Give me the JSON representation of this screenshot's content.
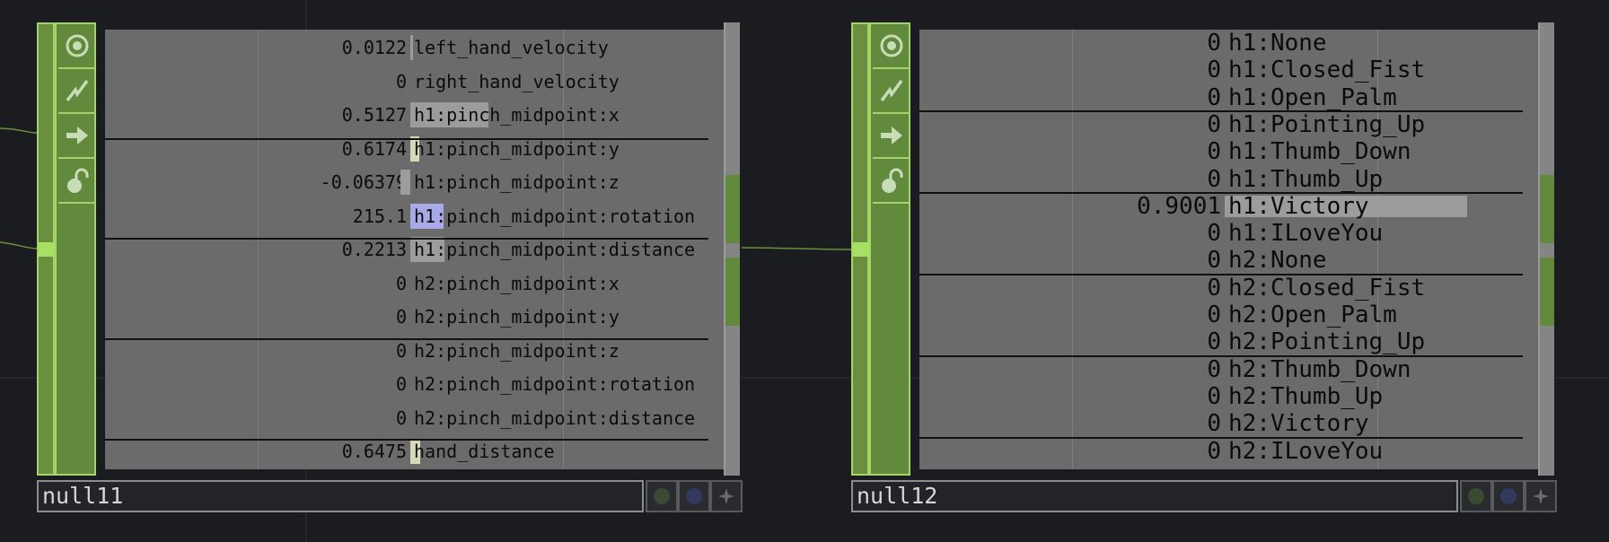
{
  "colors": {
    "background": "#1b1c20",
    "node_green": "#628a3d",
    "node_green_border": "#a3d46c",
    "viewer_gray": "#6b6b6b",
    "bar_gray": "#9c9c9c",
    "bar_cream": "#d8d8b8",
    "bar_blue": "#a9a9e8",
    "wire": "#6c8f3f"
  },
  "icons": [
    "viewer-toggle-icon",
    "bypass-icon",
    "export-icon",
    "lock-icon"
  ],
  "nodes": [
    {
      "name": "null11",
      "channels": [
        {
          "value": "0.0122",
          "label": "left_hand_velocity",
          "level": 0.012,
          "color": "#9c9c9c"
        },
        {
          "value": "0",
          "label": "right_hand_velocity",
          "level": 0,
          "color": "#9c9c9c"
        },
        {
          "value": "0.5127",
          "label": "h1:pinch_midpoint:x",
          "level": 0.5127,
          "color": "#9c9c9c"
        },
        {
          "value": "0.6174",
          "label": "h1:pinch_midpoint:y",
          "level": 0.0617,
          "color": "#d8d8b8"
        },
        {
          "value": "-0.06379",
          "label": "h1:pinch_midpoint:z",
          "level": -0.064,
          "color": "#9c9c9c"
        },
        {
          "value": "215.1",
          "label": "h1:pinch_midpoint:rotation",
          "level": 0.215,
          "color": "#a9a9e8"
        },
        {
          "value": "0.2213",
          "label": "h1:pinch_midpoint:distance",
          "level": 0.2213,
          "color": "#9c9c9c"
        },
        {
          "value": "0",
          "label": "h2:pinch_midpoint:x",
          "level": 0,
          "color": "#9c9c9c"
        },
        {
          "value": "0",
          "label": "h2:pinch_midpoint:y",
          "level": 0,
          "color": "#9c9c9c"
        },
        {
          "value": "0",
          "label": "h2:pinch_midpoint:z",
          "level": 0,
          "color": "#9c9c9c"
        },
        {
          "value": "0",
          "label": "h2:pinch_midpoint:rotation",
          "level": 0,
          "color": "#9c9c9c"
        },
        {
          "value": "0",
          "label": "h2:pinch_midpoint:distance",
          "level": 0,
          "color": "#9c9c9c"
        },
        {
          "value": "0.6475",
          "label": "hand_distance",
          "level": 0.0647,
          "color": "#d8d8b8"
        }
      ]
    },
    {
      "name": "null12",
      "channels": [
        {
          "value": "0",
          "label": "h1:None",
          "level": 0,
          "color": "#9c9c9c"
        },
        {
          "value": "0",
          "label": "h1:Closed_Fist",
          "level": 0,
          "color": "#9c9c9c"
        },
        {
          "value": "0",
          "label": "h1:Open_Palm",
          "level": 0,
          "color": "#9c9c9c"
        },
        {
          "value": "0",
          "label": "h1:Pointing_Up",
          "level": 0,
          "color": "#9c9c9c"
        },
        {
          "value": "0",
          "label": "h1:Thumb_Down",
          "level": 0,
          "color": "#9c9c9c"
        },
        {
          "value": "0",
          "label": "h1:Thumb_Up",
          "level": 0,
          "color": "#9c9c9c"
        },
        {
          "value": "0.9001",
          "label": "h1:Victory",
          "level": 0.9001,
          "color": "#9c9c9c"
        },
        {
          "value": "0",
          "label": "h1:ILoveYou",
          "level": 0,
          "color": "#9c9c9c"
        },
        {
          "value": "0",
          "label": "h2:None",
          "level": 0,
          "color": "#9c9c9c"
        },
        {
          "value": "0",
          "label": "h2:Closed_Fist",
          "level": 0,
          "color": "#9c9c9c"
        },
        {
          "value": "0",
          "label": "h2:Open_Palm",
          "level": 0,
          "color": "#9c9c9c"
        },
        {
          "value": "0",
          "label": "h2:Pointing_Up",
          "level": 0,
          "color": "#9c9c9c"
        },
        {
          "value": "0",
          "label": "h2:Thumb_Down",
          "level": 0,
          "color": "#9c9c9c"
        },
        {
          "value": "0",
          "label": "h2:Thumb_Up",
          "level": 0,
          "color": "#9c9c9c"
        },
        {
          "value": "0",
          "label": "h2:Victory",
          "level": 0,
          "color": "#9c9c9c"
        },
        {
          "value": "0",
          "label": "h2:ILoveYou",
          "level": 0,
          "color": "#9c9c9c"
        }
      ]
    }
  ]
}
